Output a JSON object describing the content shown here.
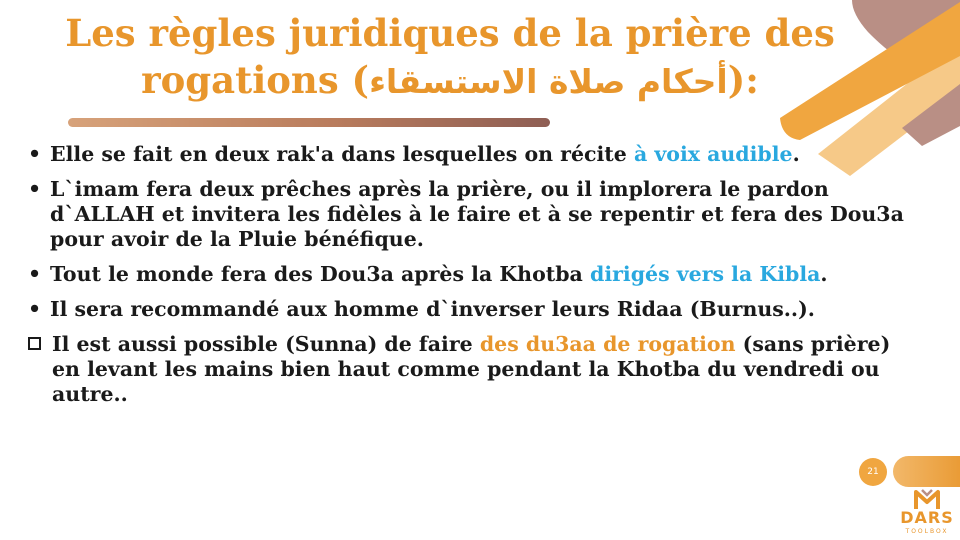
{
  "slide": {
    "title_line1": "Les règles juridiques de la prière des",
    "title_line2_prefix": "rogations (",
    "title_arabic": "أحكام صلاة الاستسقاء",
    "title_line2_suffix": "):",
    "bullets": [
      {
        "marker": "•",
        "text": "Elle se fait en deux rak'a dans lesquelles on récite ",
        "highlight": "à voix audible",
        "after": "."
      },
      {
        "marker": "•",
        "text": "L`imam fera deux prêches après la prière, ou il implorera le pardon d`ALLAH et invitera les fidèles à le faire et à se repentir et fera des Dou3a pour avoir de la Pluie bénéfique."
      },
      {
        "marker": "•",
        "text": "Tout le monde fera des Dou3a après la Khotba ",
        "highlight": "dirigés vers la Kibla",
        "after": "."
      },
      {
        "marker": "•",
        "text": "Il sera recommandé aux homme d`inverser leurs Ridaa (Burnus..)."
      },
      {
        "marker": "checkbox",
        "text": "Il est aussi possible (Sunna) de faire ",
        "highlight": "des du3aa de rogation",
        "after": " (sans prière) en levant les mains bien haut comme pendant la Khotba du vendredi ou autre.."
      }
    ],
    "page_number": "21"
  },
  "logo": {
    "text": "DARS",
    "subtext": "TOOLBOX"
  },
  "colors": {
    "accent_orange": "#e8962c",
    "highlight_blue": "#29a8df",
    "deco_brown": "#b98f85",
    "deco_orange": "#f0a640"
  }
}
